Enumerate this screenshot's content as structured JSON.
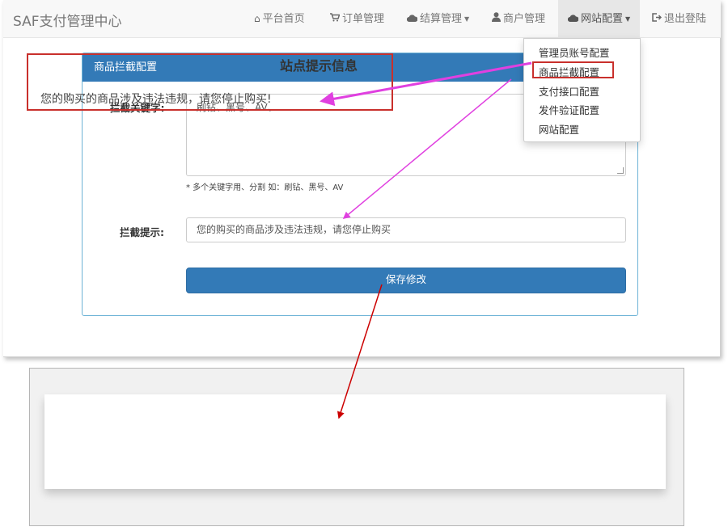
{
  "navbar": {
    "brand": "SAF支付管理中心",
    "items": [
      {
        "icon": "home-icon",
        "label": "平台首页"
      },
      {
        "icon": "cart-icon",
        "label": "订单管理"
      },
      {
        "icon": "cloud-icon",
        "label": "结算管理"
      },
      {
        "icon": "user-icon",
        "label": "商户管理"
      },
      {
        "icon": "cloud-icon",
        "label": "网站配置"
      },
      {
        "icon": "logout-icon",
        "label": "退出登陆"
      }
    ]
  },
  "dropdown": {
    "items": [
      "管理员账号配置",
      "商品拦截配置",
      "支付接口配置",
      "发件验证配置",
      "网站配置"
    ]
  },
  "panel": {
    "title": "商品拦截配置",
    "keyword_label": "拦截关键字:",
    "keyword_value": "刷钻、黑号、AV、",
    "keyword_help": "* 多个关键字用、分割 如：刷钻、黑号、AV",
    "tip_label": "拦截提示:",
    "tip_value": "您的购买的商品涉及违法违规，请您停止购买",
    "save_label": "保存修改"
  },
  "notice": {
    "title": "站点提示信息",
    "message": "您的购买的商品涉及违法违规，请您停止购买!"
  },
  "colors": {
    "primary": "#337ab7",
    "highlight_red": "#c9302c",
    "arrow_magenta": "#e040e0",
    "arrow_red": "#cc0000"
  }
}
